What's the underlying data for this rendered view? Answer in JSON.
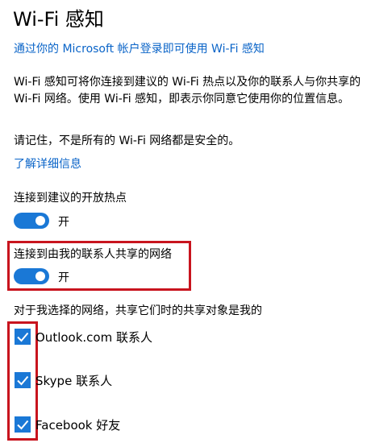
{
  "page": {
    "title": "Wi-Fi 感知",
    "signin_link": "通过你的 Microsoft 帐户登录即可使用 Wi-Fi 感知",
    "description": "Wi-Fi 感知可将你连接到建议的 Wi-Fi 热点以及你的联系人与你共享的 Wi-Fi 网络。使用 Wi-Fi 感知，即表示你同意它使用你的位置信息。",
    "note": "请记住，不是所有的 Wi-Fi 网络都是安全的。",
    "learn_more_link": "了解详细信息"
  },
  "toggles": [
    {
      "label": "连接到建议的开放热点",
      "state_text": "开",
      "on": true
    },
    {
      "label": "连接到由我的联系人共享的网络",
      "state_text": "开",
      "on": true,
      "highlighted": true
    }
  ],
  "sharing": {
    "label": "对于我选择的网络，共享它们时的共享对象是我的",
    "options": [
      {
        "label": "Outlook.com 联系人",
        "checked": true
      },
      {
        "label": "Skype 联系人",
        "checked": true
      },
      {
        "label": "Facebook 好友",
        "checked": true
      }
    ]
  },
  "colors": {
    "accent": "#1a78d6",
    "link": "#0a64c8",
    "highlight_border": "#c8141e"
  },
  "icons": {
    "checkmark": "check-icon"
  }
}
